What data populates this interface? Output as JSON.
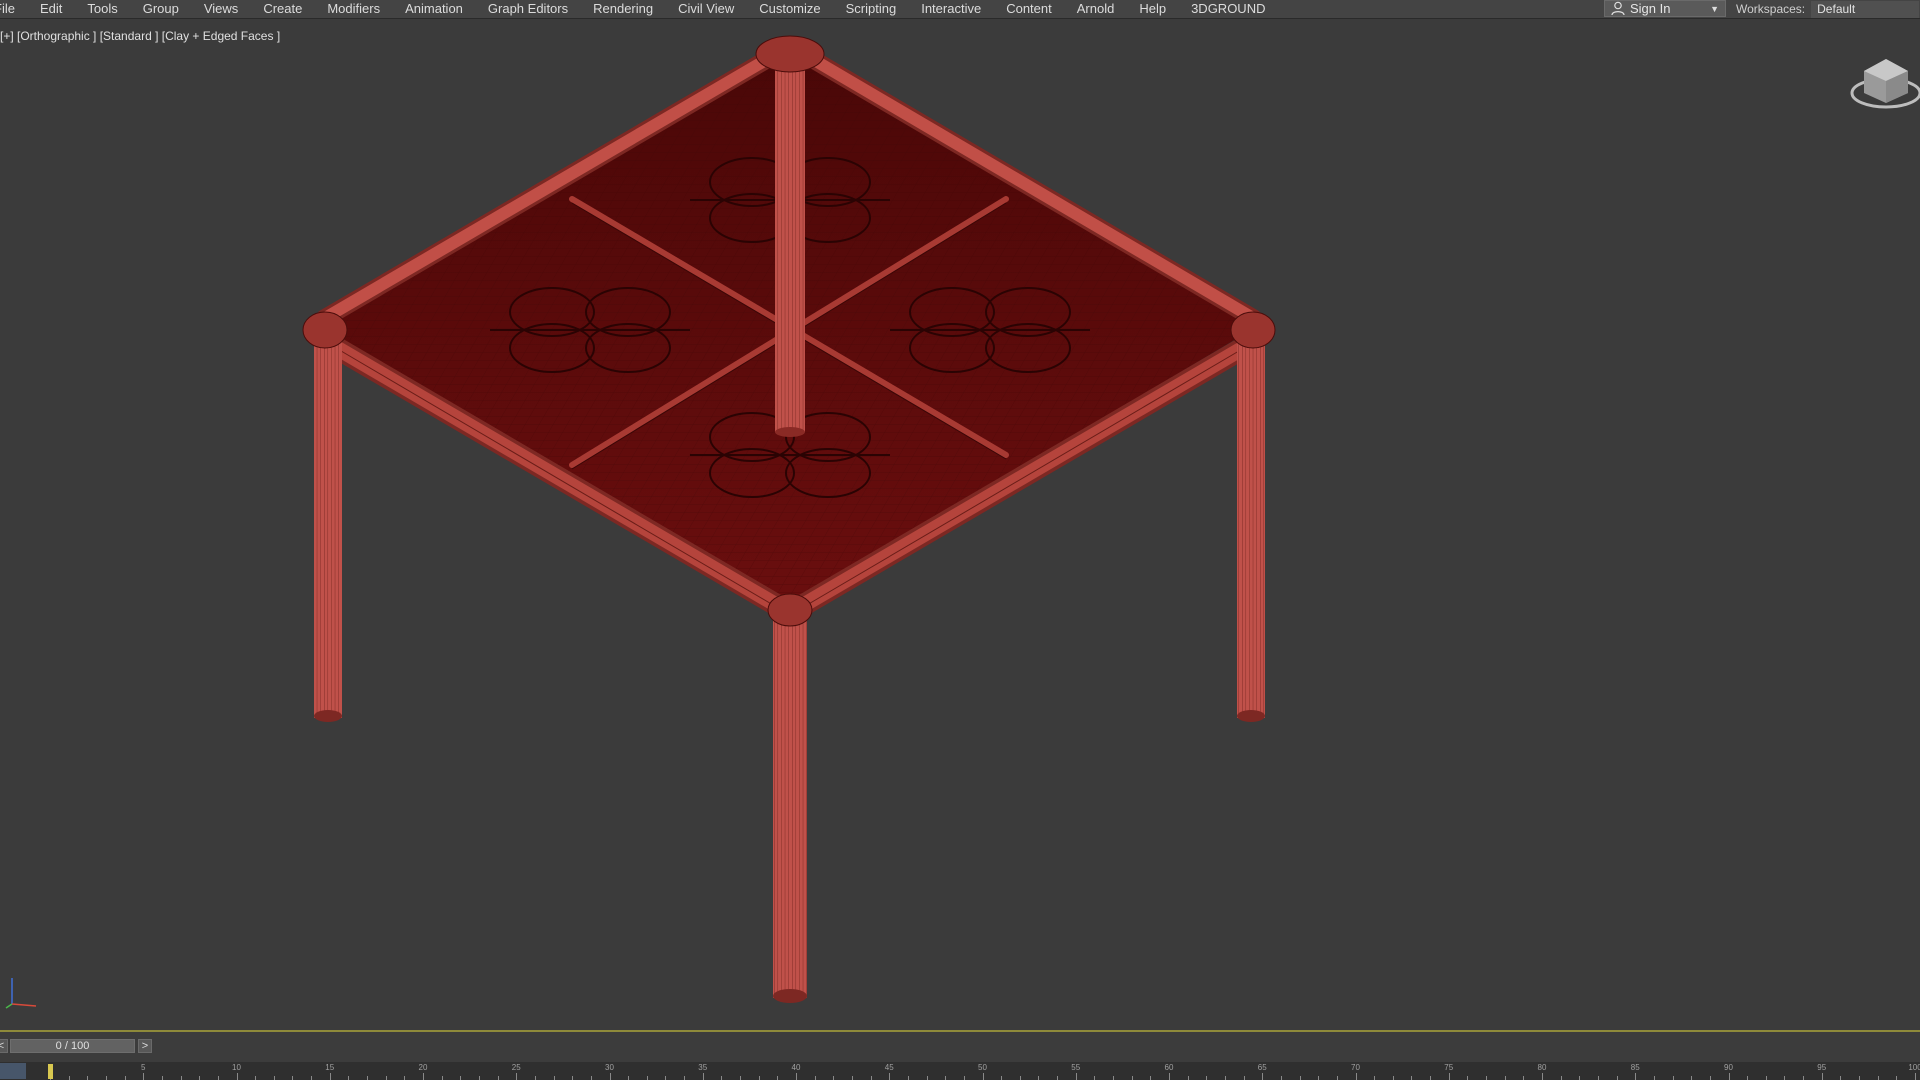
{
  "menubar": {
    "items": [
      "File",
      "Edit",
      "Tools",
      "Group",
      "Views",
      "Create",
      "Modifiers",
      "Animation",
      "Graph Editors",
      "Rendering",
      "Civil View",
      "Customize",
      "Scripting",
      "Interactive",
      "Content",
      "Arnold",
      "Help",
      "3DGROUND"
    ]
  },
  "account": {
    "sign_in_label": "Sign In",
    "user_icon": "user-icon",
    "dropdown_icon": "chevron-down-icon"
  },
  "workspaces": {
    "label": "Workspaces:",
    "value": "Default"
  },
  "viewport": {
    "label": "[+] [Orthographic ] [Standard ] [Clay + Edged Faces ]",
    "navigation_widget": "viewcube-icon",
    "axis_widget": "axis-tripod-icon",
    "model_color": "#b3463f",
    "background_color": "#3b3b3b"
  },
  "timeline": {
    "frame_display": "0 / 100",
    "prev_label": "<",
    "next_label": ">",
    "current_frame": 0,
    "total_frames": 100,
    "cursor_color": "#d8c850"
  }
}
